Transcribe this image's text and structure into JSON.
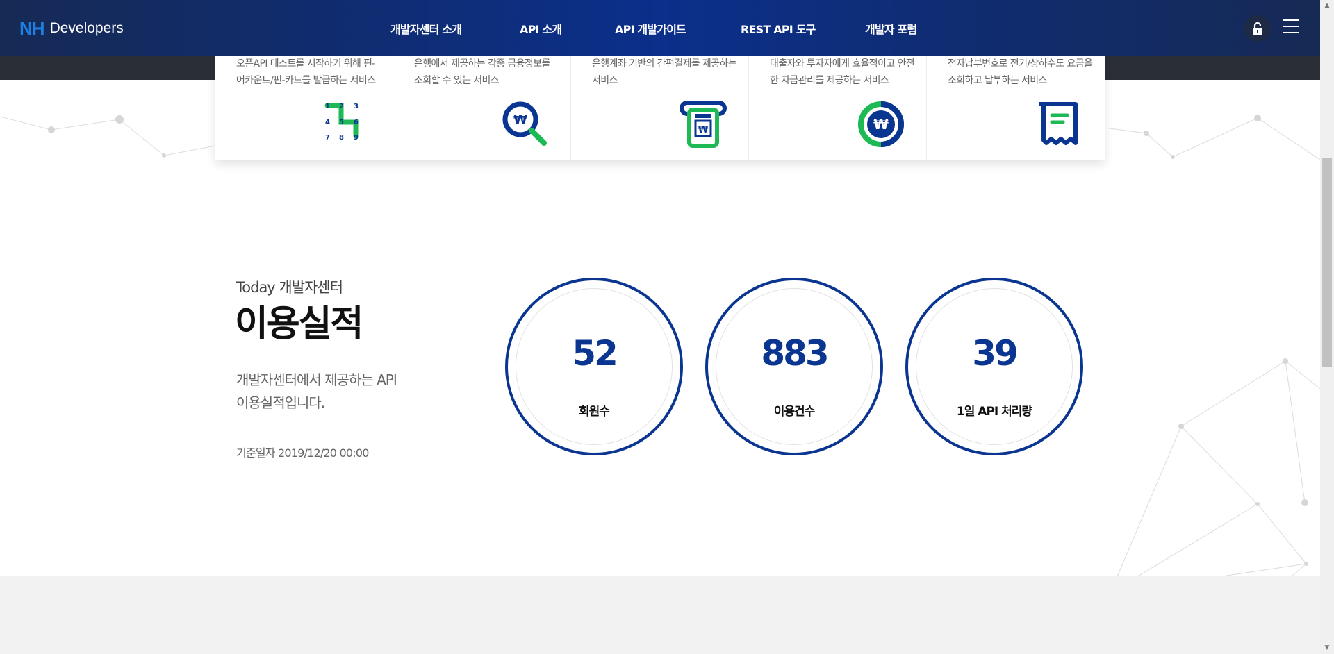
{
  "header": {
    "logo_mark": "NH",
    "logo_text": "Developers",
    "nav": [
      {
        "label": "개발자센터 소개"
      },
      {
        "label": "API 소개"
      },
      {
        "label": "API 개발가이드"
      },
      {
        "label": "REST API 도구"
      },
      {
        "label": "개발자 포럼"
      }
    ],
    "icons": {
      "lock": "lock-open-icon",
      "menu": "hamburger-menu-icon"
    }
  },
  "services": [
    {
      "desc": "오픈API 테스트를 시작하기 위해 핀-어카운트/핀-카드를 발급하는 서비스",
      "icon": "number-grid-icon",
      "digits": [
        "1",
        "2",
        "3",
        "4",
        "5",
        "6",
        "7",
        "8",
        "9"
      ]
    },
    {
      "desc": "은행에서 제공하는 각종 금융정보를 조회할 수 있는 서비스",
      "icon": "won-search-icon"
    },
    {
      "desc": "은행계좌 기반의 간편결제를 제공하는 서비스",
      "icon": "won-card-payment-icon"
    },
    {
      "desc": "대출자와 투자자에게 효율적이고 안전한 자금관리를 제공하는 서비스",
      "icon": "won-coin-icon"
    },
    {
      "desc": "전자납부번호로 전기/상하수도 요금을 조회하고 납부하는 서비스",
      "icon": "receipt-icon"
    }
  ],
  "stats_section": {
    "subtitle": "Today 개발자센터",
    "title": "이용실적",
    "desc_line1": "개발자센터에서 제공하는 API",
    "desc_line2": "이용실적입니다.",
    "basis": "기준일자 2019/12/20 00:00",
    "stats": [
      {
        "value": "52",
        "label": "회원수"
      },
      {
        "value": "883",
        "label": "이용건수"
      },
      {
        "value": "39",
        "label": "1일 API 처리량"
      }
    ]
  },
  "colors": {
    "brand_blue": "#0a3590",
    "accent_green": "#1db954",
    "logo_blue": "#1f7fe0"
  }
}
